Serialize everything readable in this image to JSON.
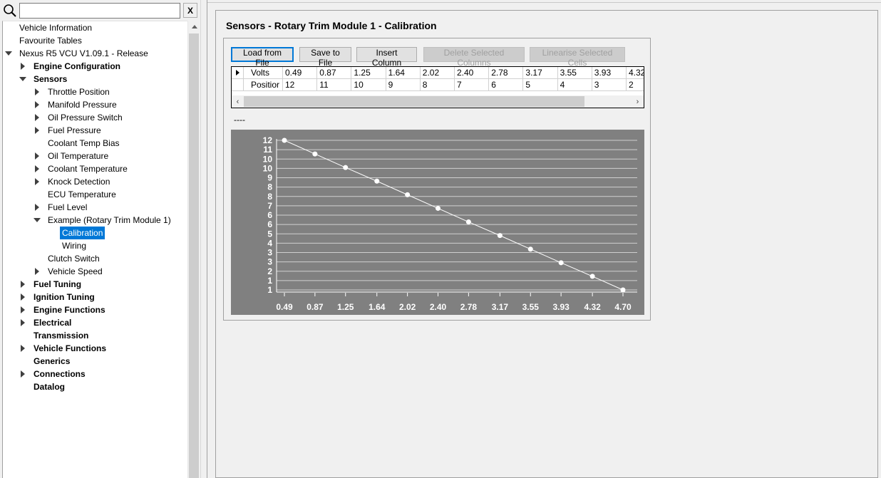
{
  "search": {
    "placeholder": "",
    "clear_label": "X"
  },
  "tree": [
    {
      "label": "Vehicle Information",
      "level": 0,
      "toggle": "none",
      "bold": false,
      "selected": false
    },
    {
      "label": "Favourite Tables",
      "level": 0,
      "toggle": "none",
      "bold": false,
      "selected": false
    },
    {
      "label": "Nexus R5 VCU V1.09.1 - Release",
      "level": 0,
      "toggle": "expanded",
      "bold": false,
      "selected": false
    },
    {
      "label": "Engine Configuration",
      "level": 1,
      "toggle": "collapsed",
      "bold": true,
      "selected": false
    },
    {
      "label": "Sensors",
      "level": 1,
      "toggle": "expanded",
      "bold": true,
      "selected": false
    },
    {
      "label": "Throttle Position",
      "level": 2,
      "toggle": "collapsed",
      "bold": false,
      "selected": false
    },
    {
      "label": "Manifold Pressure",
      "level": 2,
      "toggle": "collapsed",
      "bold": false,
      "selected": false
    },
    {
      "label": "Oil Pressure Switch",
      "level": 2,
      "toggle": "collapsed",
      "bold": false,
      "selected": false
    },
    {
      "label": "Fuel Pressure",
      "level": 2,
      "toggle": "collapsed",
      "bold": false,
      "selected": false
    },
    {
      "label": "Coolant Temp Bias",
      "level": 2,
      "toggle": "none",
      "bold": false,
      "selected": false
    },
    {
      "label": "Oil Temperature",
      "level": 2,
      "toggle": "collapsed",
      "bold": false,
      "selected": false
    },
    {
      "label": "Coolant Temperature",
      "level": 2,
      "toggle": "collapsed",
      "bold": false,
      "selected": false
    },
    {
      "label": "Knock Detection",
      "level": 2,
      "toggle": "collapsed",
      "bold": false,
      "selected": false
    },
    {
      "label": "ECU Temperature",
      "level": 2,
      "toggle": "none",
      "bold": false,
      "selected": false
    },
    {
      "label": "Fuel Level",
      "level": 2,
      "toggle": "collapsed",
      "bold": false,
      "selected": false
    },
    {
      "label": "Example (Rotary Trim Module 1)",
      "level": 2,
      "toggle": "expanded",
      "bold": false,
      "selected": false
    },
    {
      "label": "Calibration",
      "level": 3,
      "toggle": "none",
      "bold": false,
      "selected": true
    },
    {
      "label": "Wiring",
      "level": 3,
      "toggle": "none",
      "bold": false,
      "selected": false
    },
    {
      "label": "Clutch Switch",
      "level": 2,
      "toggle": "none",
      "bold": false,
      "selected": false
    },
    {
      "label": "Vehicle Speed",
      "level": 2,
      "toggle": "collapsed",
      "bold": false,
      "selected": false
    },
    {
      "label": "Fuel Tuning",
      "level": 1,
      "toggle": "collapsed",
      "bold": true,
      "selected": false
    },
    {
      "label": "Ignition Tuning",
      "level": 1,
      "toggle": "collapsed",
      "bold": true,
      "selected": false
    },
    {
      "label": "Engine Functions",
      "level": 1,
      "toggle": "collapsed",
      "bold": true,
      "selected": false
    },
    {
      "label": "Electrical",
      "level": 1,
      "toggle": "collapsed",
      "bold": true,
      "selected": false
    },
    {
      "label": "Transmission",
      "level": 1,
      "toggle": "none",
      "bold": true,
      "selected": false
    },
    {
      "label": "Vehicle Functions",
      "level": 1,
      "toggle": "collapsed",
      "bold": true,
      "selected": false
    },
    {
      "label": "Generics",
      "level": 1,
      "toggle": "none",
      "bold": true,
      "selected": false
    },
    {
      "label": "Connections",
      "level": 1,
      "toggle": "collapsed",
      "bold": true,
      "selected": false
    },
    {
      "label": "Datalog",
      "level": 1,
      "toggle": "none",
      "bold": true,
      "selected": false
    }
  ],
  "page": {
    "title": "Sensors - Rotary Trim Module 1 - Calibration"
  },
  "toolbar": {
    "load_label": "Load from File",
    "save_label": "Save to File",
    "insert_label": "Insert Column",
    "delete_label": "Delete Selected Columns",
    "linearise_label": "Linearise Selected Cells"
  },
  "table": {
    "rows": [
      {
        "header": "Volts",
        "cells": [
          "0.49",
          "0.87",
          "1.25",
          "1.64",
          "2.02",
          "2.40",
          "2.78",
          "3.17",
          "3.55",
          "3.93",
          "4.32"
        ]
      },
      {
        "header": "Positior",
        "cells": [
          "12",
          "11",
          "10",
          "9",
          "8",
          "7",
          "6",
          "5",
          "4",
          "3",
          "2"
        ]
      }
    ]
  },
  "dash_text": "----",
  "colors": {
    "chart_bg": "#808080",
    "selection": "#0078d7"
  },
  "chart_data": {
    "type": "line",
    "x": [
      0.49,
      0.87,
      1.25,
      1.64,
      2.02,
      2.4,
      2.78,
      3.17,
      3.55,
      3.93,
      4.32,
      4.7
    ],
    "y": [
      12,
      11,
      10,
      9,
      8,
      7,
      6,
      5,
      4,
      3,
      2,
      1
    ],
    "xticks": [
      "0.49",
      "0.87",
      "1.25",
      "1.64",
      "2.02",
      "2.40",
      "2.78",
      "3.17",
      "3.55",
      "3.93",
      "4.32",
      "4.70"
    ],
    "yticks": [
      "12",
      "11",
      "10",
      "10",
      "9",
      "8",
      "8",
      "7",
      "6",
      "6",
      "5",
      "4",
      "3",
      "3",
      "2",
      "1",
      "1"
    ],
    "ylim": [
      1,
      12
    ],
    "grid": true,
    "title": "",
    "xlabel": "",
    "ylabel": ""
  }
}
